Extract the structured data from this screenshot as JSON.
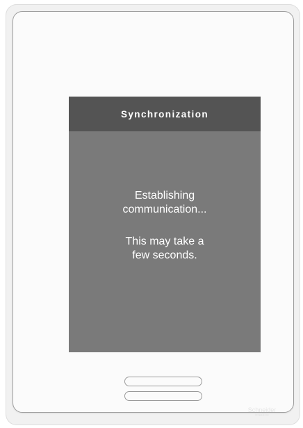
{
  "screen": {
    "title": "Synchronization",
    "message_1": [
      "Establishing",
      "communication..."
    ],
    "message_2": [
      "This may take a",
      "few seconds."
    ]
  },
  "brand": {
    "name": "Schneider",
    "sub": "Electric"
  },
  "colors": {
    "header_bg": "#545454",
    "screen_bg": "#7a7a7a",
    "text": "#ffffff",
    "bezel": "#fbfbfb"
  }
}
